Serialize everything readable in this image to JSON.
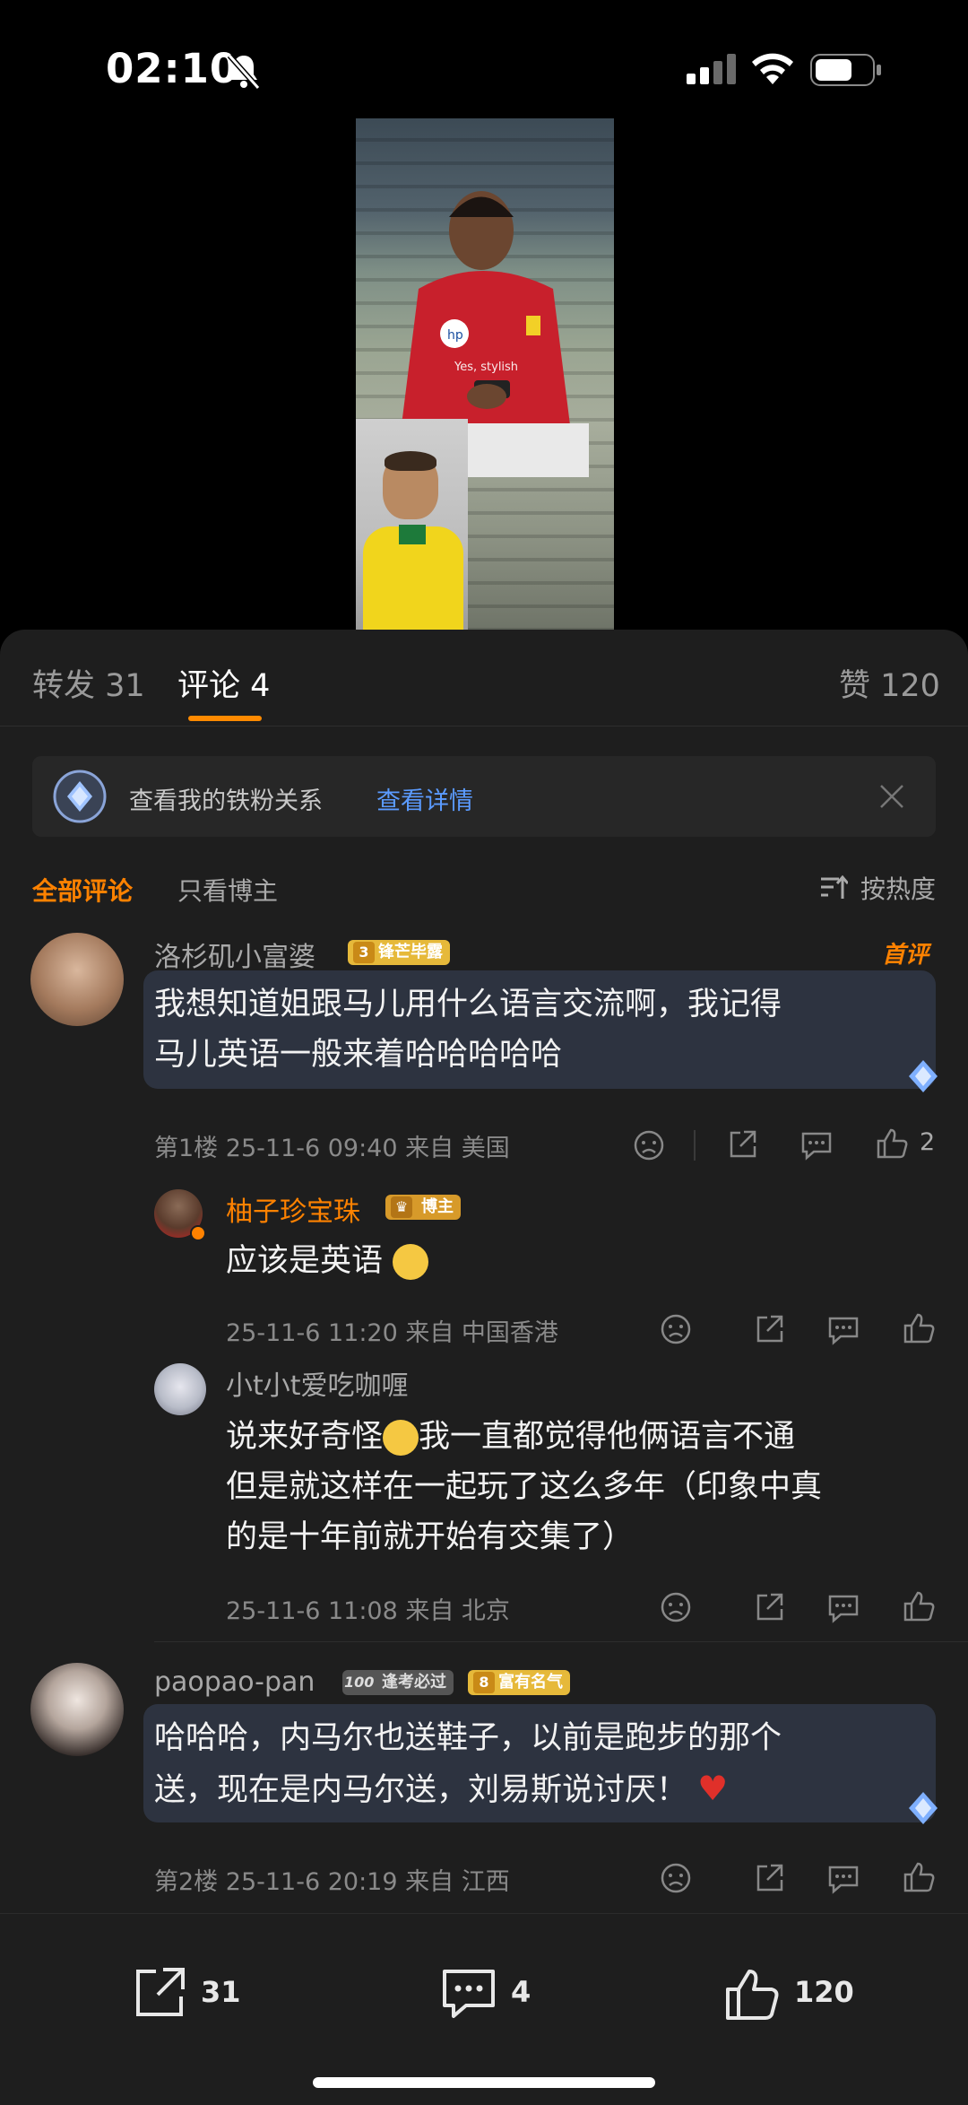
{
  "status_bar": {
    "time": "02:10"
  },
  "video": {
    "caption": "Yes, stylish"
  },
  "tabs": {
    "repost": "转发 31",
    "comments": "评论 4",
    "likes": "赞 120"
  },
  "fans_banner": {
    "text": "查看我的铁粉关系",
    "link": "查看详情"
  },
  "filters": {
    "all": "全部评论",
    "author_only": "只看博主",
    "sort": "按热度"
  },
  "comments": [
    {
      "name": "洛杉矶小富婆",
      "badge_level": "3",
      "badge_text": "锋芒毕露",
      "tag": "首评",
      "text_line1": "我想知道姐跟马儿用什么语言交流啊，我记得",
      "text_line2": "马儿英语一般来着哈哈哈哈哈",
      "meta": "第1楼 25-11-6 09:40 来自 美国",
      "likes": "2",
      "replies": [
        {
          "name": "柚子珍宝珠",
          "badge_text": "博主",
          "text": "应该是英语",
          "meta": "25-11-6 11:20 来自 中国香港"
        },
        {
          "name": "小t小t爱吃咖喱",
          "text_line1": "说来好奇怪",
          "text_line1b": "我一直都觉得他俩语言不通",
          "text_line2": "但是就这样在一起玩了这么多年（印象中真",
          "text_line3": "的是十年前就开始有交集了）",
          "meta": "25-11-6 11:08 来自 北京"
        }
      ]
    },
    {
      "name": "paopao-pan",
      "badge_gray": "逢考必过",
      "badge_gray_num": "100",
      "badge_level": "8",
      "badge_text": "富有名气",
      "text_line1": "哈哈哈，内马尔也送鞋子，以前是跑步的那个",
      "text_line2": "送，现在是内马尔送，刘易斯说讨厌！",
      "meta": "第2楼 25-11-6 20:19 来自 江西"
    }
  ],
  "bottom_bar": {
    "repost_count": "31",
    "comment_count": "4",
    "like_count": "120"
  },
  "colors": {
    "accent": "#ff8200",
    "link": "#5b9bff",
    "background": "#1e1e1e"
  }
}
